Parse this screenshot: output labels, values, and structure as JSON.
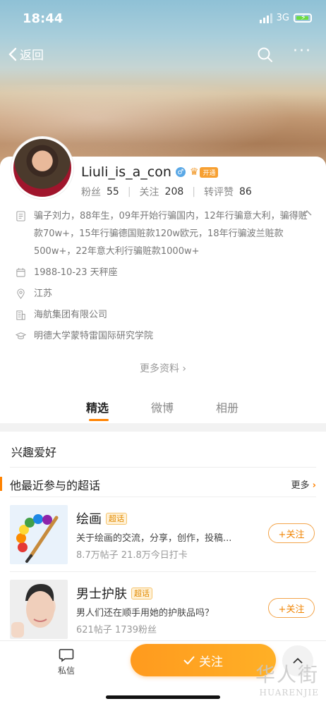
{
  "status_bar": {
    "time": "18:44",
    "network": "3G"
  },
  "nav": {
    "back_label": "返回",
    "search_icon": "search-icon",
    "more_icon": "more-dots-icon"
  },
  "profile": {
    "username": "Liuli_is_a_con",
    "gender": "♂",
    "vip_tag": "开通",
    "stats": {
      "fans_label": "粉丝",
      "fans": "55",
      "following_label": "关注",
      "following": "208",
      "reposts_label": "转评赞",
      "reposts": "86"
    },
    "bio": "骗子刘力，88年生，09年开始行骗国内，12年行骗意大利，骗得赃款70w+，15年行骗德国赃款120w欧元，18年行骗波兰赃款500w+，22年意大利行骗赃款1000w+",
    "birthday": "1988-10-23 天秤座",
    "location": "江苏",
    "company": "海航集团有限公司",
    "school": "明德大学蒙特雷国际研究学院",
    "more_info": "更多资料"
  },
  "tabs": [
    {
      "label": "精选",
      "active": true
    },
    {
      "label": "微博",
      "active": false
    },
    {
      "label": "相册",
      "active": false
    }
  ],
  "interests": {
    "title": "兴趣爱好",
    "supertopics_title": "他最近参与的超话",
    "more_label": "更多",
    "items": [
      {
        "name": "绘画",
        "badge": "超话",
        "desc": "关于绘画的交流，分享，创作，投稿...",
        "stats": "8.7万帖子 21.8万今日打卡",
        "follow": "+关注"
      },
      {
        "name": "男士护肤",
        "badge": "超话",
        "desc": "男人们还在顺手用她的护肤品吗？",
        "stats": "621帖子 1739粉丝",
        "follow": "+关注"
      }
    ]
  },
  "bottom": {
    "dm_label": "私信",
    "follow_label": "关注"
  },
  "watermark": {
    "cn": "华人街",
    "en": "HUARENJIE"
  },
  "colors": {
    "accent": "#ff8200",
    "follow_gradient_start": "#ff9a1e",
    "follow_gradient_end": "#ffb026"
  }
}
